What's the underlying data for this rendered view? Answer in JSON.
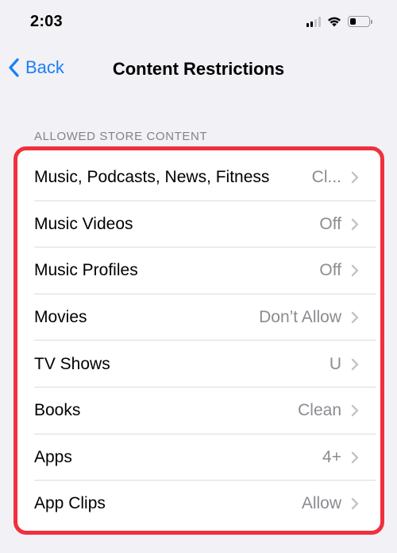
{
  "status_bar": {
    "time": "2:03",
    "signal_icon": "cellular-signal-icon",
    "wifi_icon": "wifi-icon",
    "battery_icon": "battery-icon",
    "battery_level": 0.3
  },
  "nav": {
    "back_label": "Back",
    "title": "Content Restrictions"
  },
  "section": {
    "header": "ALLOWED STORE CONTENT",
    "highlight_color": "#f0303d",
    "rows": [
      {
        "label": "Music, Podcasts, News, Fitness",
        "value": "Cl..."
      },
      {
        "label": "Music Videos",
        "value": "Off"
      },
      {
        "label": "Music Profiles",
        "value": "Off"
      },
      {
        "label": "Movies",
        "value": "Don’t Allow"
      },
      {
        "label": "TV Shows",
        "value": "U"
      },
      {
        "label": "Books",
        "value": "Clean"
      },
      {
        "label": "Apps",
        "value": "4+"
      },
      {
        "label": "App Clips",
        "value": "Allow"
      }
    ]
  },
  "colors": {
    "accent": "#1a7ff5",
    "background": "#f2f1f6"
  }
}
